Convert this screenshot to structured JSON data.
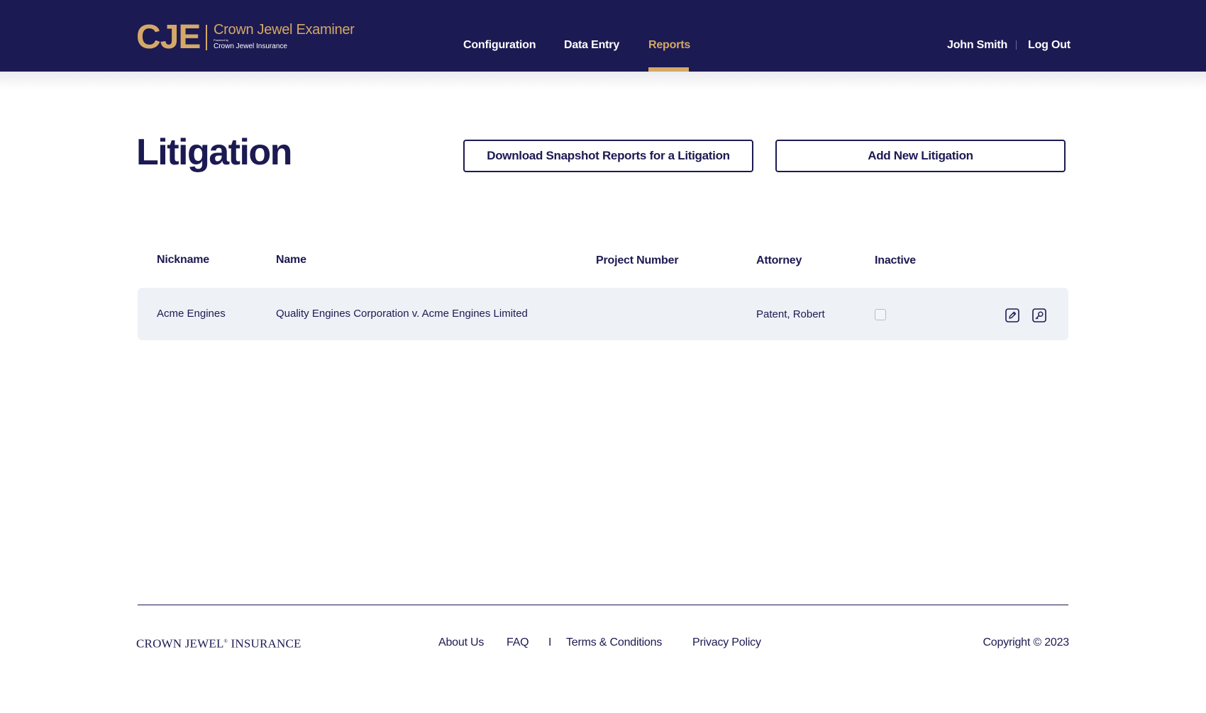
{
  "brand": {
    "mark": "CJE",
    "title": "Crown Jewel Examiner",
    "powered_by": "Powered by",
    "subtitle": "Crown Jewel Insurance"
  },
  "nav": {
    "items": [
      {
        "label": "Configuration",
        "active": false
      },
      {
        "label": "Data Entry",
        "active": false
      },
      {
        "label": "Reports",
        "active": true
      }
    ]
  },
  "user": {
    "name": "John Smith",
    "logout_label": "Log Out"
  },
  "page": {
    "title": "Litigation",
    "download_button": "Download Snapshot Reports for a Litigation",
    "add_button": "Add New Litigation"
  },
  "table": {
    "columns": [
      "Nickname",
      "Name",
      "Project Number",
      "Attorney",
      "Inactive"
    ],
    "rows": [
      {
        "nickname": "Acme Engines",
        "name": "Quality Engines Corporation v. Acme Engines Limited",
        "project_number": "",
        "attorney": "Patent, Robert",
        "inactive": false,
        "actions": [
          "edit-icon",
          "key-icon"
        ]
      }
    ]
  },
  "footer": {
    "brand_left": "CROWN JEWEL",
    "brand_mark": "®",
    "brand_right": "INSURANCE",
    "links": [
      "About Us",
      "FAQ",
      "Terms & Conditions",
      "Privacy Policy"
    ],
    "separator": "I",
    "copyright": "Copyright © 2023"
  },
  "colors": {
    "navy": "#1c1a52",
    "gold": "#d4a868",
    "row_bg": "#eef1f6"
  }
}
